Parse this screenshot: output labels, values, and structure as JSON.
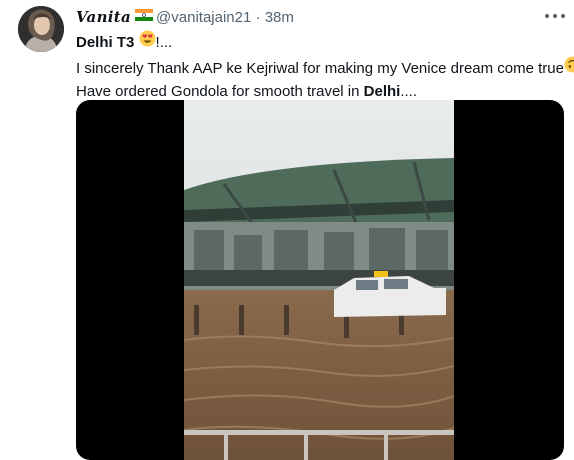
{
  "user": {
    "display_name": "Vanita",
    "handle": "@vanitajain21",
    "separator": "·",
    "time": "38m",
    "flag_icon": "india-flag-icon",
    "avatar": "user-avatar-photo"
  },
  "tweet": {
    "line1_bold": "Delhi T3",
    "line1_emoji": "heart-eyes-emoji",
    "line1_rest": "!...",
    "line2": "I sincerely Thank AAP ke Kejriwal for making my Venice dream come true",
    "line2_emoji": "upside-down-face-emoji",
    "line3_prefix": "Have ordered Gondola for smooth travel in ",
    "line3_bold": "Delhi",
    "line3_suffix": "...."
  },
  "menu": {
    "icon": "more-options-icon"
  },
  "media": {
    "type": "video",
    "description_icon": "video-thumbnail"
  },
  "colors": {
    "text": "#0f1419",
    "secondary": "#536471",
    "media_bg": "#000000"
  }
}
